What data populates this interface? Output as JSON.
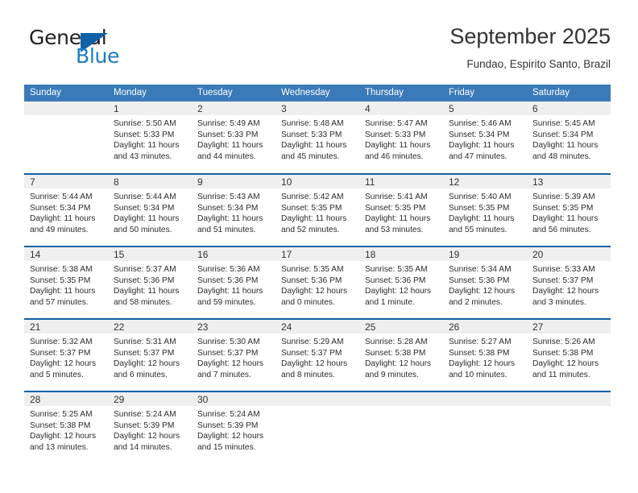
{
  "brand": {
    "name_top": "General",
    "name_bottom": "Blue",
    "accent_color": "#1062a8",
    "text_color": "#231f20",
    "triangle_icon": "triangle-right-icon"
  },
  "header": {
    "title": "September 2025",
    "subtitle": "Fundao, Espirito Santo, Brazil"
  },
  "theme": {
    "header_blue": "#3a7ab8",
    "separator_blue": "#1060a8",
    "daynum_band": "#efefef",
    "body_text": "#2b2b2b"
  },
  "calendar": {
    "weekday_headers": [
      "Sunday",
      "Monday",
      "Tuesday",
      "Wednesday",
      "Thursday",
      "Friday",
      "Saturday"
    ],
    "weeks": [
      [
        {
          "day": "",
          "sunrise": "",
          "sunset": "",
          "daylight1": "",
          "daylight2": ""
        },
        {
          "day": "1",
          "sunrise": "Sunrise: 5:50 AM",
          "sunset": "Sunset: 5:33 PM",
          "daylight1": "Daylight: 11 hours",
          "daylight2": "and 43 minutes."
        },
        {
          "day": "2",
          "sunrise": "Sunrise: 5:49 AM",
          "sunset": "Sunset: 5:33 PM",
          "daylight1": "Daylight: 11 hours",
          "daylight2": "and 44 minutes."
        },
        {
          "day": "3",
          "sunrise": "Sunrise: 5:48 AM",
          "sunset": "Sunset: 5:33 PM",
          "daylight1": "Daylight: 11 hours",
          "daylight2": "and 45 minutes."
        },
        {
          "day": "4",
          "sunrise": "Sunrise: 5:47 AM",
          "sunset": "Sunset: 5:33 PM",
          "daylight1": "Daylight: 11 hours",
          "daylight2": "and 46 minutes."
        },
        {
          "day": "5",
          "sunrise": "Sunrise: 5:46 AM",
          "sunset": "Sunset: 5:34 PM",
          "daylight1": "Daylight: 11 hours",
          "daylight2": "and 47 minutes."
        },
        {
          "day": "6",
          "sunrise": "Sunrise: 5:45 AM",
          "sunset": "Sunset: 5:34 PM",
          "daylight1": "Daylight: 11 hours",
          "daylight2": "and 48 minutes."
        }
      ],
      [
        {
          "day": "7",
          "sunrise": "Sunrise: 5:44 AM",
          "sunset": "Sunset: 5:34 PM",
          "daylight1": "Daylight: 11 hours",
          "daylight2": "and 49 minutes."
        },
        {
          "day": "8",
          "sunrise": "Sunrise: 5:44 AM",
          "sunset": "Sunset: 5:34 PM",
          "daylight1": "Daylight: 11 hours",
          "daylight2": "and 50 minutes."
        },
        {
          "day": "9",
          "sunrise": "Sunrise: 5:43 AM",
          "sunset": "Sunset: 5:34 PM",
          "daylight1": "Daylight: 11 hours",
          "daylight2": "and 51 minutes."
        },
        {
          "day": "10",
          "sunrise": "Sunrise: 5:42 AM",
          "sunset": "Sunset: 5:35 PM",
          "daylight1": "Daylight: 11 hours",
          "daylight2": "and 52 minutes."
        },
        {
          "day": "11",
          "sunrise": "Sunrise: 5:41 AM",
          "sunset": "Sunset: 5:35 PM",
          "daylight1": "Daylight: 11 hours",
          "daylight2": "and 53 minutes."
        },
        {
          "day": "12",
          "sunrise": "Sunrise: 5:40 AM",
          "sunset": "Sunset: 5:35 PM",
          "daylight1": "Daylight: 11 hours",
          "daylight2": "and 55 minutes."
        },
        {
          "day": "13",
          "sunrise": "Sunrise: 5:39 AM",
          "sunset": "Sunset: 5:35 PM",
          "daylight1": "Daylight: 11 hours",
          "daylight2": "and 56 minutes."
        }
      ],
      [
        {
          "day": "14",
          "sunrise": "Sunrise: 5:38 AM",
          "sunset": "Sunset: 5:35 PM",
          "daylight1": "Daylight: 11 hours",
          "daylight2": "and 57 minutes."
        },
        {
          "day": "15",
          "sunrise": "Sunrise: 5:37 AM",
          "sunset": "Sunset: 5:36 PM",
          "daylight1": "Daylight: 11 hours",
          "daylight2": "and 58 minutes."
        },
        {
          "day": "16",
          "sunrise": "Sunrise: 5:36 AM",
          "sunset": "Sunset: 5:36 PM",
          "daylight1": "Daylight: 11 hours",
          "daylight2": "and 59 minutes."
        },
        {
          "day": "17",
          "sunrise": "Sunrise: 5:35 AM",
          "sunset": "Sunset: 5:36 PM",
          "daylight1": "Daylight: 12 hours",
          "daylight2": "and 0 minutes."
        },
        {
          "day": "18",
          "sunrise": "Sunrise: 5:35 AM",
          "sunset": "Sunset: 5:36 PM",
          "daylight1": "Daylight: 12 hours",
          "daylight2": "and 1 minute."
        },
        {
          "day": "19",
          "sunrise": "Sunrise: 5:34 AM",
          "sunset": "Sunset: 5:36 PM",
          "daylight1": "Daylight: 12 hours",
          "daylight2": "and 2 minutes."
        },
        {
          "day": "20",
          "sunrise": "Sunrise: 5:33 AM",
          "sunset": "Sunset: 5:37 PM",
          "daylight1": "Daylight: 12 hours",
          "daylight2": "and 3 minutes."
        }
      ],
      [
        {
          "day": "21",
          "sunrise": "Sunrise: 5:32 AM",
          "sunset": "Sunset: 5:37 PM",
          "daylight1": "Daylight: 12 hours",
          "daylight2": "and 5 minutes."
        },
        {
          "day": "22",
          "sunrise": "Sunrise: 5:31 AM",
          "sunset": "Sunset: 5:37 PM",
          "daylight1": "Daylight: 12 hours",
          "daylight2": "and 6 minutes."
        },
        {
          "day": "23",
          "sunrise": "Sunrise: 5:30 AM",
          "sunset": "Sunset: 5:37 PM",
          "daylight1": "Daylight: 12 hours",
          "daylight2": "and 7 minutes."
        },
        {
          "day": "24",
          "sunrise": "Sunrise: 5:29 AM",
          "sunset": "Sunset: 5:37 PM",
          "daylight1": "Daylight: 12 hours",
          "daylight2": "and 8 minutes."
        },
        {
          "day": "25",
          "sunrise": "Sunrise: 5:28 AM",
          "sunset": "Sunset: 5:38 PM",
          "daylight1": "Daylight: 12 hours",
          "daylight2": "and 9 minutes."
        },
        {
          "day": "26",
          "sunrise": "Sunrise: 5:27 AM",
          "sunset": "Sunset: 5:38 PM",
          "daylight1": "Daylight: 12 hours",
          "daylight2": "and 10 minutes."
        },
        {
          "day": "27",
          "sunrise": "Sunrise: 5:26 AM",
          "sunset": "Sunset: 5:38 PM",
          "daylight1": "Daylight: 12 hours",
          "daylight2": "and 11 minutes."
        }
      ],
      [
        {
          "day": "28",
          "sunrise": "Sunrise: 5:25 AM",
          "sunset": "Sunset: 5:38 PM",
          "daylight1": "Daylight: 12 hours",
          "daylight2": "and 13 minutes."
        },
        {
          "day": "29",
          "sunrise": "Sunrise: 5:24 AM",
          "sunset": "Sunset: 5:39 PM",
          "daylight1": "Daylight: 12 hours",
          "daylight2": "and 14 minutes."
        },
        {
          "day": "30",
          "sunrise": "Sunrise: 5:24 AM",
          "sunset": "Sunset: 5:39 PM",
          "daylight1": "Daylight: 12 hours",
          "daylight2": "and 15 minutes."
        },
        {
          "day": "",
          "sunrise": "",
          "sunset": "",
          "daylight1": "",
          "daylight2": ""
        },
        {
          "day": "",
          "sunrise": "",
          "sunset": "",
          "daylight1": "",
          "daylight2": ""
        },
        {
          "day": "",
          "sunrise": "",
          "sunset": "",
          "daylight1": "",
          "daylight2": ""
        },
        {
          "day": "",
          "sunrise": "",
          "sunset": "",
          "daylight1": "",
          "daylight2": ""
        }
      ]
    ]
  }
}
